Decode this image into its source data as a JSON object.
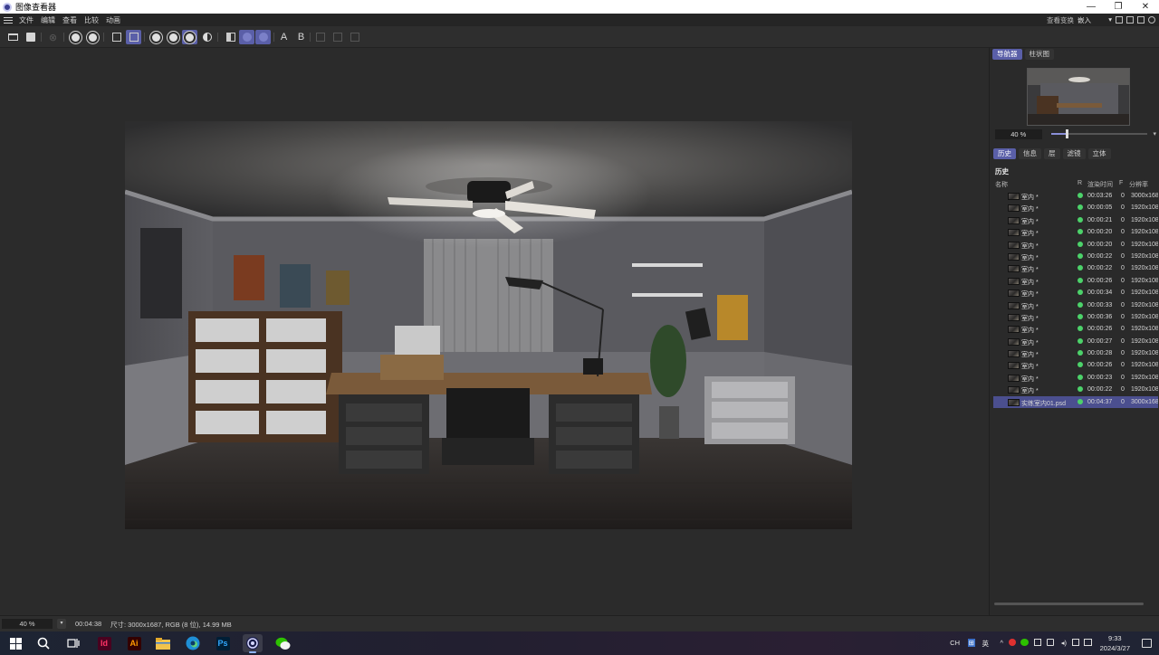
{
  "window": {
    "title": "图像查看器",
    "minimize": "—",
    "restore": "❐",
    "close": "✕"
  },
  "menu": {
    "items": [
      "文件",
      "编辑",
      "查看",
      "比较",
      "动画"
    ],
    "view_transform_label": "查看变换",
    "view_transform_value": "嵌入",
    "caret": "▾"
  },
  "toolbar": {
    "letter_a": "A",
    "letter_b": "B"
  },
  "panel": {
    "top_tabs": [
      "导航器",
      "柱状图"
    ],
    "zoom_value": "40 %",
    "zoom_fraction": 0.16,
    "caret": "▾",
    "history_tabs": [
      "历史",
      "信息",
      "层",
      "滤镜",
      "立体"
    ],
    "history_title": "历史",
    "columns": {
      "name": "名称",
      "r": "R",
      "time": "渲染时间",
      "f": "F",
      "res": "分辨率"
    },
    "history": [
      {
        "name": "室内 *",
        "time": "00:03:26",
        "f": "0",
        "res": "3000x1687"
      },
      {
        "name": "室内 *",
        "time": "00:00:05",
        "f": "0",
        "res": "1920x1080"
      },
      {
        "name": "室内 *",
        "time": "00:00:21",
        "f": "0",
        "res": "1920x1080"
      },
      {
        "name": "室内 *",
        "time": "00:00:20",
        "f": "0",
        "res": "1920x1080"
      },
      {
        "name": "室内 *",
        "time": "00:00:20",
        "f": "0",
        "res": "1920x1080"
      },
      {
        "name": "室内 *",
        "time": "00:00:22",
        "f": "0",
        "res": "1920x1080"
      },
      {
        "name": "室内 *",
        "time": "00:00:22",
        "f": "0",
        "res": "1920x1080"
      },
      {
        "name": "室内 *",
        "time": "00:00:26",
        "f": "0",
        "res": "1920x1080"
      },
      {
        "name": "室内 *",
        "time": "00:00:34",
        "f": "0",
        "res": "1920x1080"
      },
      {
        "name": "室内 *",
        "time": "00:00:33",
        "f": "0",
        "res": "1920x1080"
      },
      {
        "name": "室内 *",
        "time": "00:00:36",
        "f": "0",
        "res": "1920x1080"
      },
      {
        "name": "室内 *",
        "time": "00:00:26",
        "f": "0",
        "res": "1920x1080"
      },
      {
        "name": "室内 *",
        "time": "00:00:27",
        "f": "0",
        "res": "1920x1080"
      },
      {
        "name": "室内 *",
        "time": "00:00:28",
        "f": "0",
        "res": "1920x1080"
      },
      {
        "name": "室内 *",
        "time": "00:00:26",
        "f": "0",
        "res": "1920x1080"
      },
      {
        "name": "室内 *",
        "time": "00:00:23",
        "f": "0",
        "res": "1920x1080"
      },
      {
        "name": "室内 *",
        "time": "00:00:22",
        "f": "0",
        "res": "1920x1080"
      },
      {
        "name": "实练室内01.psd",
        "time": "00:04:37",
        "f": "0",
        "res": "3000x1687",
        "selected": true
      }
    ]
  },
  "status": {
    "zoom": "40 %",
    "caret": "▾",
    "render_time": "00:04:38",
    "info": "尺寸: 3000x1687, RGB (8 位), 14.99 MB"
  },
  "taskbar": {
    "apps": [
      "Id",
      "Ai",
      "Ps"
    ],
    "lang_short": "CH",
    "ime": "英",
    "ime_box": "⊞",
    "time": "9:33",
    "date": "2024/3/27"
  },
  "colors": {
    "accent": "#5a5fa8",
    "status_green": "#4cd26a",
    "indesign": "#ff3366",
    "illustrator": "#ff9a00",
    "photoshop": "#31a8ff"
  }
}
